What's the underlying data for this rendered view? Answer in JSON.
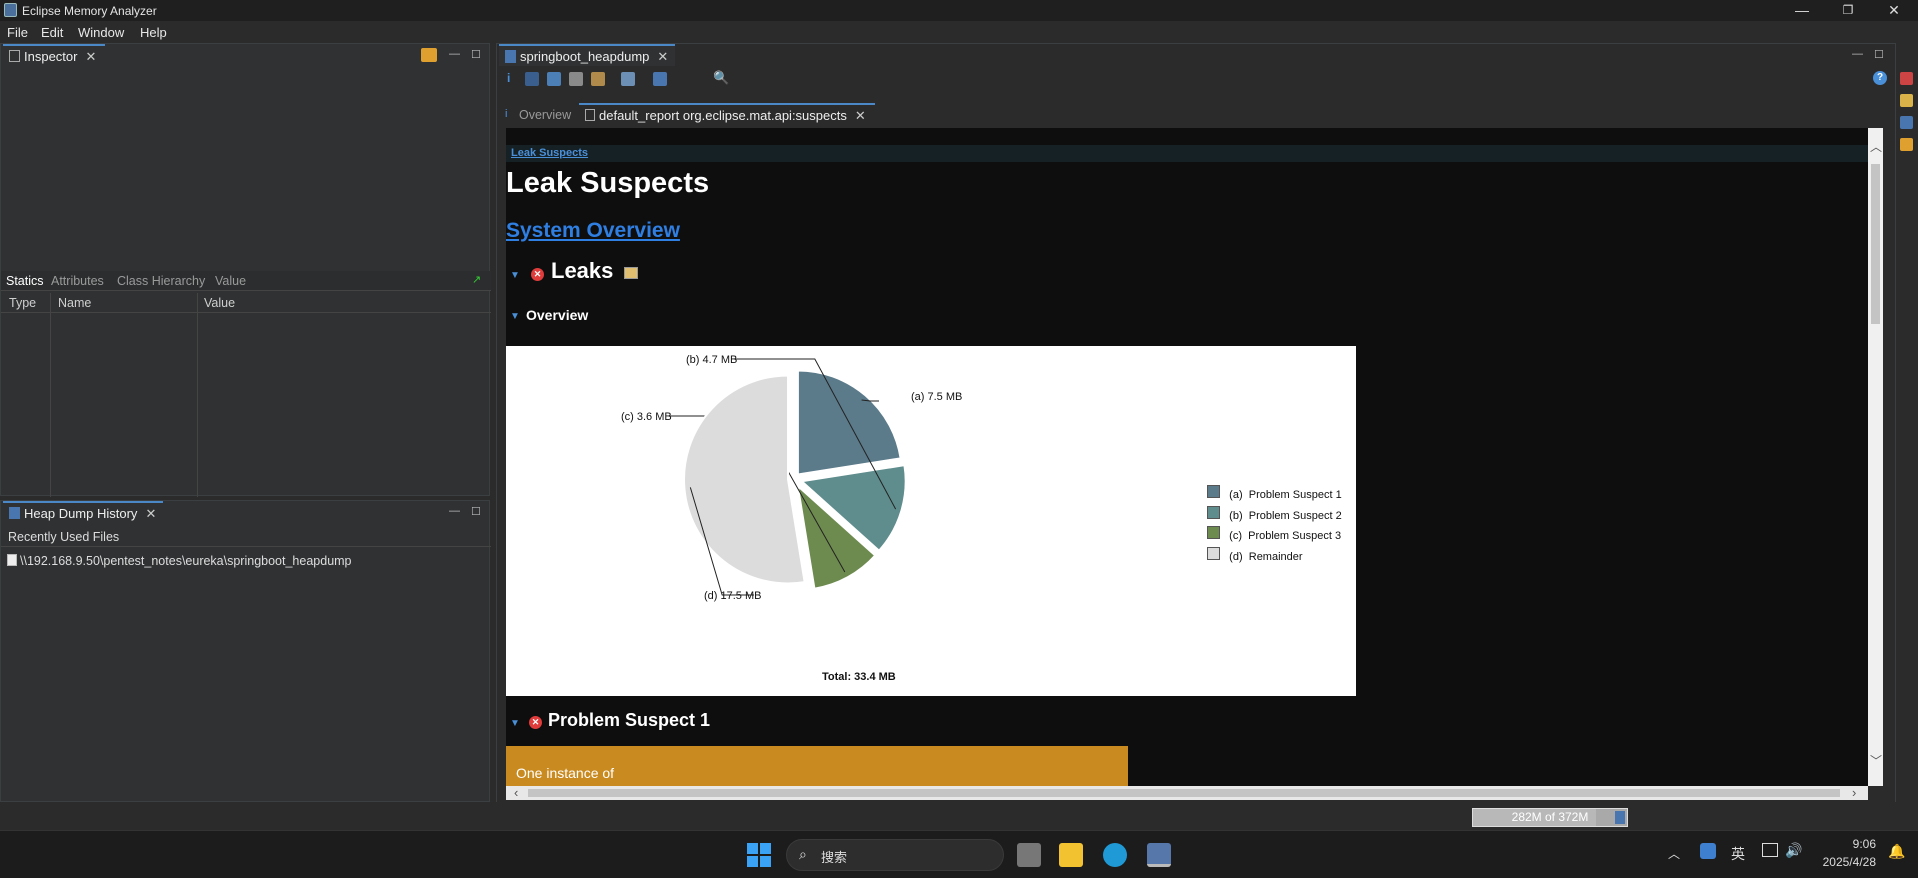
{
  "window": {
    "title": "Eclipse Memory Analyzer",
    "minimize": "—",
    "restore": "❐",
    "close": "✕"
  },
  "menu": [
    "File",
    "Edit",
    "Window",
    "Help"
  ],
  "inspector": {
    "tab_label": "Inspector",
    "subtabs": [
      "Statics",
      "Attributes",
      "Class Hierarchy",
      "Value"
    ],
    "columns": [
      "Type",
      "Name",
      "Value"
    ]
  },
  "heap_history": {
    "tab_label": "Heap Dump History",
    "section": "Recently Used Files",
    "files": [
      "\\\\192.168.9.50\\pentest_notes\\eureka\\springboot_heapdump"
    ]
  },
  "editor": {
    "tab_label": "springboot_heapdump",
    "subtabs": {
      "overview": "Overview",
      "report": "default_report org.eclipse.mat.api:suspects"
    }
  },
  "report": {
    "breadcrumb": "Leak Suspects",
    "title": "Leak Suspects",
    "system_overview": "System Overview",
    "leaks": "Leaks",
    "overview": "Overview",
    "problem_suspect_1": "Problem Suspect 1",
    "suspect_text": "One instance of"
  },
  "chart_data": {
    "type": "pie",
    "unit": "MB",
    "slices": [
      {
        "label": "(a)",
        "legend": "Problem Suspect 1",
        "value": 7.5,
        "display": "(a)  7.5 MB",
        "color": "#5b7a8a"
      },
      {
        "label": "(b)",
        "legend": "Problem Suspect 2",
        "value": 4.7,
        "display": "(b)  4.7 MB",
        "color": "#5f8c8c"
      },
      {
        "label": "(c)",
        "legend": "Problem Suspect 3",
        "value": 3.6,
        "display": "(c)  3.6 MB",
        "color": "#6d8a4f"
      },
      {
        "label": "(d)",
        "legend": "Remainder",
        "value": 17.5,
        "display": "(d)  17.5 MB",
        "color": "#dcdcdc"
      }
    ],
    "total": "Total: 33.4 MB"
  },
  "status": {
    "heap": "282M of 372M"
  },
  "taskbar": {
    "search_placeholder": "搜索",
    "time": "9:06",
    "date": "2025/4/28",
    "ime": "英"
  }
}
